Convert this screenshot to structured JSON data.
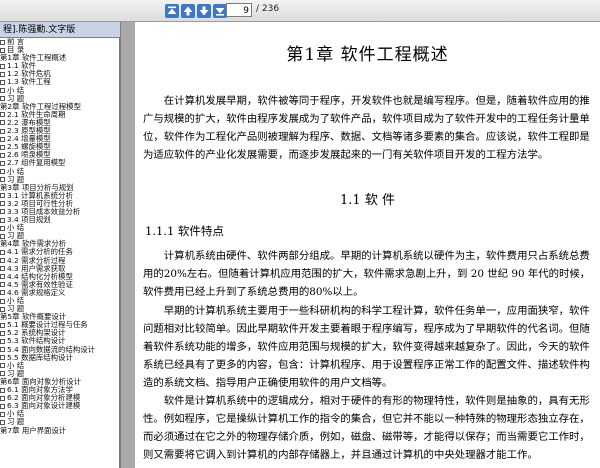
{
  "toolbar": {
    "page_current": "9",
    "page_total": "/ 236",
    "buttons": [
      "first-page",
      "previous-page",
      "next-page",
      "last-page"
    ]
  },
  "tab": {
    "title": "程].陈强勤.文字版"
  },
  "toc": [
    "前  言",
    "目  录",
    "第1章  软件工程概述",
    "1.1  软件",
    "1.2  软件危机",
    "1.3  软件工程",
    "小  结",
    "习  题",
    "第2章  软件工程过程模型",
    "2.1  软件生命周期",
    "2.2  瀑布模型",
    "2.3  原型模型",
    "2.4  增量模型",
    "2.5  螺旋模型",
    "2.6  喷泉模型",
    "2.7  组件复用模型",
    "小  结",
    "习  题",
    "第3章  项目分析与规划",
    "3.1  计算机系统分析",
    "3.2  项目可行性分析",
    "3.3  项目成本效益分析",
    "3.4  项目规划",
    "小  结",
    "习  题",
    "第4章  软件需求分析",
    "4.1  需求分析的任务",
    "4.2  需求分析过程",
    "4.3  用户需求获取",
    "4.4  结构化分析模型",
    "4.5  需求有效性验证",
    "4.6  需求规格定义",
    "小  结",
    "习  题",
    "第5章  软件概要设计",
    "5.1  概要设计过程与任务",
    "5.2  系统构架设计",
    "5.3  软件结构设计",
    "5.4  面向数据流的结构设计",
    "5.5  数据库结构设计",
    "小  结",
    "习  题",
    "第6章  面向对象分析设计",
    "6.1  面向对象方法学",
    "6.2  面向对象分析建模",
    "6.3  面向对象设计建模",
    "小  结",
    "习  题",
    "第7章  用户界面设计"
  ],
  "page": {
    "chapter_title": "第1章    软件工程概述",
    "intro": "在计算机发展早期，软件被等同于程序，开发软件也就是编写程序。但是，随着软件应用的推广与规模的扩大，软件由程序发展成为了软件产品，软件项目成为了软件开发中的工程任务计量单位，软件作为工程化产品则被理解为程序、数据、文档等诸多要素的集合。应该说，软件工程即是为适应软件的产业化发展需要，而逐步发展起来的一门有关软件项目开发的工程方法学。",
    "section_title": "1.1    软      件",
    "subsection_title": "1.1.1   软件特点",
    "p1": "计算机系统由硬件、软件两部分组成。早期的计算机系统以硬件为主，软件费用只占系统总费用的20%左右。但随着计算机应用范围的扩大，软件需求急剧上升，到 20 世纪 90 年代的时候，软件费用已经上升到了系统总费用的80%以上。",
    "p2": "早期的计算机系统主要用于一些科研机构的科学工程计算，软件任务单一，应用面狭窄，软件问题相对比较简单。因此早期软件开发主要着眼于程序编写，程序成为了早期软件的代名词。但随着软件系统功能的增多，软件应用范围与规模的扩大，软件变得越来越复杂了。因此，今天的软件系统已经具有了更多的内容，包含：计算机程序、用于设置程序正常工作的配置文件、描述软件构造的系统文档、指导用户正确使用软件的用户文档等。",
    "p3": "软件是计算机系统中的逻辑成分，相对于硬件的有形的物理特性，软件则是抽象的，具有无形性。例如程序，它是操纵计算机工作的指令的集合，但它并不能以一种特殊的物理形态独立存在，而必须通过在它之外的物理存储介质，例如，磁盘、磁带等，才能得以保存；而当需要它工作时，则又需要将它调入到计算机的内部存储器上，并且通过计算机的中央处理器才能工作。"
  }
}
